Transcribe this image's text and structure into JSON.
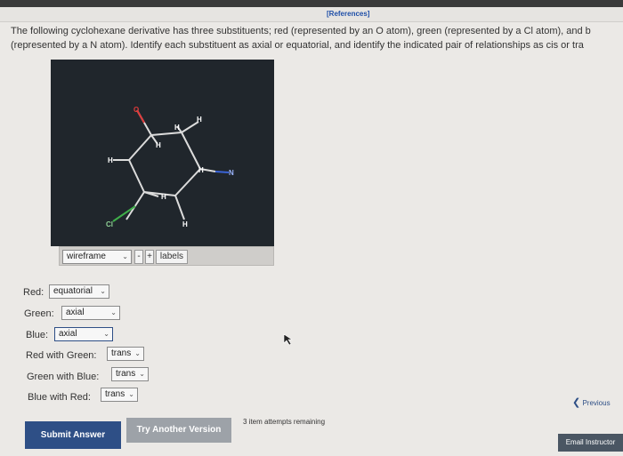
{
  "references_label": "[References]",
  "question_line1": "The following cyclohexane derivative has three substituents; red (represented by an O atom), green (represented by a Cl atom), and b",
  "question_line2": "(represented by a N atom). Identify each substituent as axial or equatorial, and identify the indicated pair of relationships as cis or tra",
  "viewer": {
    "atoms": {
      "O": "O",
      "Cl": "Cl",
      "N": "N",
      "H": "H"
    },
    "controls": {
      "mode": "wireframe",
      "minus": "-",
      "plus": "+",
      "labels": "labels"
    }
  },
  "answers": [
    {
      "label": "Red:",
      "value": "equatorial"
    },
    {
      "label": "Green:",
      "value": "axial"
    },
    {
      "label": "Blue:",
      "value": "axial"
    },
    {
      "label": "Red with Green:",
      "value": "trans"
    },
    {
      "label": "Green with Blue:",
      "value": "trans"
    },
    {
      "label": "Blue with Red:",
      "value": "trans"
    }
  ],
  "buttons": {
    "submit": "Submit Answer",
    "try": "Try Another Version",
    "attempts": "3 item attempts remaining",
    "previous": "Previous",
    "email": "Email Instructor"
  },
  "colors": {
    "accent": "#2e4f86",
    "red": "#e03a3a",
    "green": "#3fae4a",
    "blue": "#3a64d8"
  }
}
